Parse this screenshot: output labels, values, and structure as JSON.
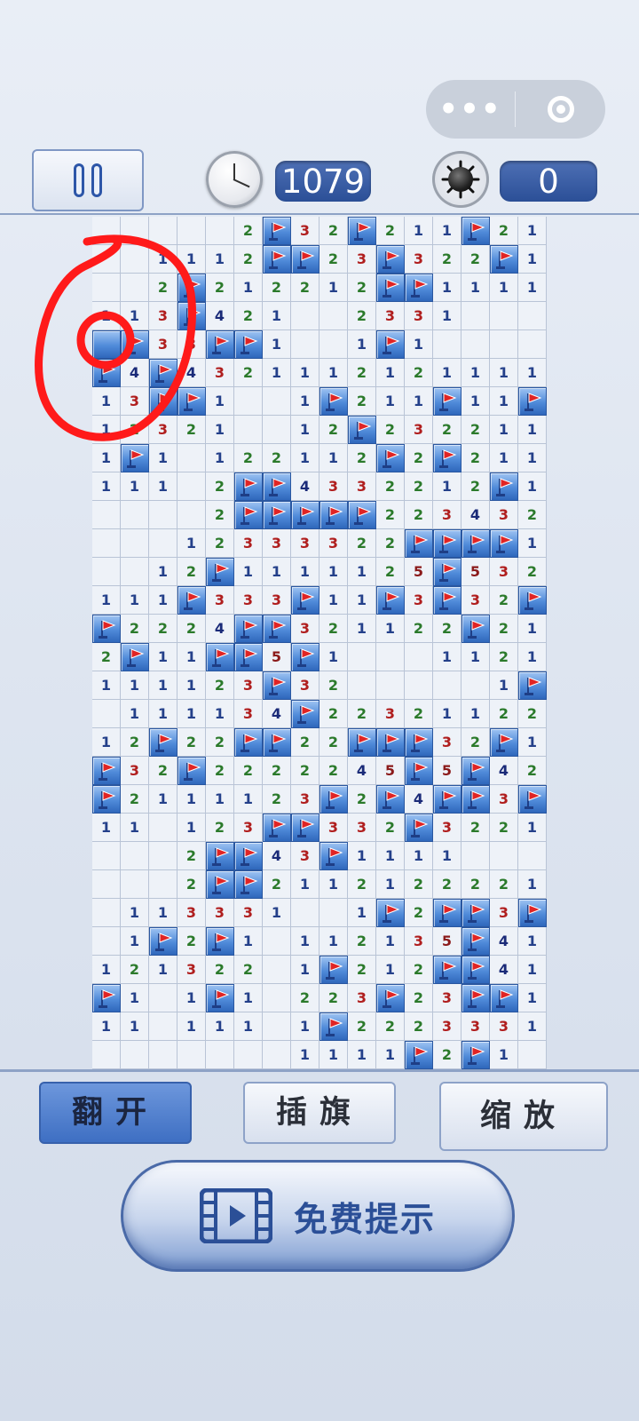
{
  "header": {
    "timer_value": "1079",
    "mine_count": "0",
    "more_icon": "more-dots-icon",
    "close_icon": "target-icon"
  },
  "board": {
    "columns": 16,
    "rows": [
      [
        "",
        "",
        "",
        "",
        "",
        "2",
        "F",
        "3",
        "2",
        "F",
        "2",
        "1",
        "1",
        "F",
        "2",
        "1"
      ],
      [
        "",
        "",
        "1",
        "1",
        "1",
        "2",
        "F",
        "F",
        "2",
        "3",
        "F",
        "3",
        "2",
        "2",
        "F",
        "1"
      ],
      [
        "",
        "",
        "2",
        "F",
        "2",
        "1",
        "2",
        "2",
        "1",
        "2",
        "F",
        "F",
        "1",
        "1",
        "1",
        "1"
      ],
      [
        "1",
        "1",
        "3",
        "F",
        "4",
        "2",
        "1",
        "",
        "",
        "2",
        "3",
        "3",
        "1",
        "",
        "",
        ""
      ],
      [
        "H",
        "F",
        "3",
        "3",
        "F",
        "F",
        "1",
        "",
        "",
        "1",
        "F",
        "1",
        "",
        "",
        "",
        ""
      ],
      [
        "F",
        "4",
        "F",
        "4",
        "3",
        "2",
        "1",
        "1",
        "1",
        "2",
        "1",
        "2",
        "1",
        "1",
        "1",
        "1"
      ],
      [
        "1",
        "3",
        "F",
        "F",
        "1",
        "",
        "",
        "1",
        "F",
        "2",
        "1",
        "1",
        "F",
        "1",
        "1",
        "F"
      ],
      [
        "1",
        "2",
        "3",
        "2",
        "1",
        "",
        "",
        "1",
        "2",
        "F",
        "2",
        "3",
        "2",
        "2",
        "1",
        "1"
      ],
      [
        "1",
        "F",
        "1",
        "",
        "1",
        "2",
        "2",
        "1",
        "1",
        "2",
        "F",
        "2",
        "F",
        "2",
        "1",
        "1"
      ],
      [
        "1",
        "1",
        "1",
        "",
        "2",
        "F",
        "F",
        "4",
        "3",
        "3",
        "2",
        "2",
        "1",
        "2",
        "F",
        "1"
      ],
      [
        "",
        "",
        "",
        "",
        "2",
        "F",
        "F",
        "F",
        "F",
        "F",
        "2",
        "2",
        "3",
        "4",
        "3",
        "2"
      ],
      [
        "",
        "",
        "",
        "1",
        "2",
        "3",
        "3",
        "3",
        "3",
        "2",
        "2",
        "F",
        "F",
        "F",
        "F",
        "1"
      ],
      [
        "",
        "",
        "1",
        "2",
        "F",
        "1",
        "1",
        "1",
        "1",
        "1",
        "2",
        "5",
        "F",
        "5",
        "3",
        "2"
      ],
      [
        "1",
        "1",
        "1",
        "F",
        "3",
        "3",
        "3",
        "F",
        "1",
        "1",
        "F",
        "3",
        "F",
        "3",
        "2",
        "F"
      ],
      [
        "F",
        "2",
        "2",
        "2",
        "4",
        "F",
        "F",
        "3",
        "2",
        "1",
        "1",
        "2",
        "2",
        "F",
        "2",
        "1"
      ],
      [
        "2",
        "F",
        "1",
        "1",
        "F",
        "F",
        "5",
        "F",
        "1",
        "",
        "",
        "",
        "1",
        "1",
        "2",
        "1"
      ],
      [
        "1",
        "1",
        "1",
        "1",
        "2",
        "3",
        "F",
        "3",
        "2",
        "",
        "",
        "",
        "",
        "",
        "1",
        "F"
      ],
      [
        "",
        "1",
        "1",
        "1",
        "1",
        "3",
        "4",
        "F",
        "2",
        "2",
        "3",
        "2",
        "1",
        "1",
        "2",
        "2"
      ],
      [
        "1",
        "2",
        "F",
        "2",
        "2",
        "F",
        "F",
        "2",
        "2",
        "F",
        "F",
        "F",
        "3",
        "2",
        "F",
        "1"
      ],
      [
        "F",
        "3",
        "2",
        "F",
        "2",
        "2",
        "2",
        "2",
        "2",
        "4",
        "5",
        "F",
        "5",
        "F",
        "4",
        "2"
      ],
      [
        "F",
        "2",
        "1",
        "1",
        "1",
        "1",
        "2",
        "3",
        "F",
        "2",
        "F",
        "4",
        "F",
        "F",
        "3",
        "F"
      ],
      [
        "1",
        "1",
        "",
        "1",
        "2",
        "3",
        "F",
        "F",
        "3",
        "3",
        "2",
        "F",
        "3",
        "2",
        "2",
        "1"
      ],
      [
        "",
        "",
        "",
        "2",
        "F",
        "F",
        "4",
        "3",
        "F",
        "1",
        "1",
        "1",
        "1",
        "",
        "",
        ""
      ],
      [
        "",
        "",
        "",
        "2",
        "F",
        "F",
        "2",
        "1",
        "1",
        "2",
        "1",
        "2",
        "2",
        "2",
        "2",
        "1"
      ],
      [
        "",
        "1",
        "1",
        "3",
        "3",
        "3",
        "1",
        "",
        "",
        "1",
        "F",
        "2",
        "F",
        "F",
        "3",
        "F"
      ],
      [
        "",
        "1",
        "F",
        "2",
        "F",
        "1",
        "",
        "1",
        "1",
        "2",
        "1",
        "3",
        "5",
        "F",
        "4",
        "1"
      ],
      [
        "1",
        "2",
        "1",
        "3",
        "2",
        "2",
        "",
        "1",
        "F",
        "2",
        "1",
        "2",
        "F",
        "F",
        "4",
        "1"
      ],
      [
        "F",
        "1",
        "",
        "1",
        "F",
        "1",
        "",
        "2",
        "2",
        "3",
        "F",
        "2",
        "3",
        "F",
        "F",
        "1"
      ],
      [
        "1",
        "1",
        "",
        "1",
        "1",
        "1",
        "",
        "1",
        "F",
        "2",
        "2",
        "2",
        "3",
        "3",
        "3",
        "1"
      ],
      [
        "",
        "",
        "",
        "",
        "",
        "",
        "",
        "1",
        "1",
        "1",
        "1",
        "F",
        "2",
        "F",
        "1",
        ""
      ]
    ]
  },
  "toolbar": {
    "reveal_label": "翻开",
    "flag_label": "插旗",
    "zoom_label": "缩放"
  },
  "hint": {
    "label": "免费提示",
    "icon": "video-film-icon"
  },
  "annotation": {
    "color": "#ff1a1a"
  }
}
